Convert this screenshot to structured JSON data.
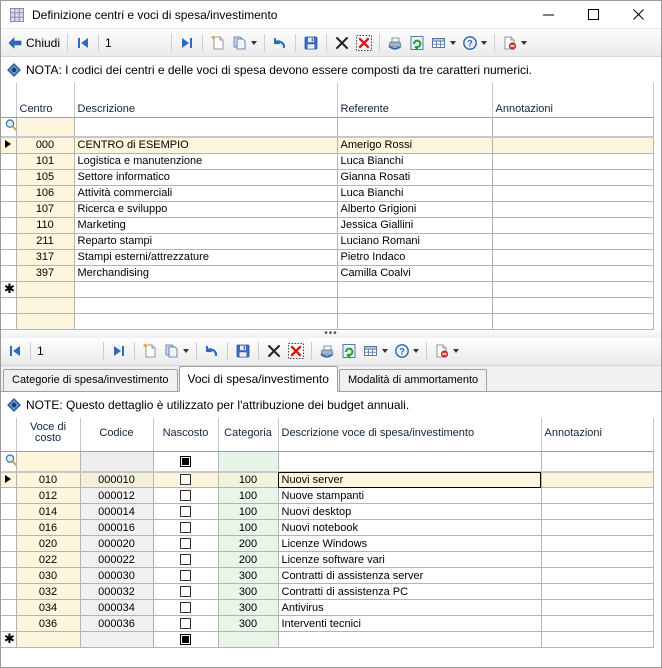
{
  "window": {
    "title": "Definizione centri e voci di spesa/investimento",
    "app_icon": "grid-icon",
    "minimize": "─",
    "maximize": "□",
    "close": "✕"
  },
  "toolbar_top": {
    "close_label": "Chiudi",
    "record_number": "1",
    "items": [
      {
        "name": "close-button",
        "icon": "back-arrow-icon",
        "label": "Chiudi"
      },
      {
        "name": "first-record-button",
        "icon": "first-record-icon"
      },
      {
        "name": "record-number-input",
        "icon": "",
        "value": "1"
      },
      {
        "name": "last-record-button",
        "icon": "last-record-icon"
      },
      {
        "name": "new-record-button",
        "icon": "new-document-icon"
      },
      {
        "name": "duplicate-record-button",
        "icon": "copy-document-icon",
        "dropdown": true
      },
      {
        "name": "undo-button",
        "icon": "undo-icon"
      },
      {
        "name": "save-button",
        "icon": "save-disk-icon"
      },
      {
        "name": "delete-button",
        "icon": "delete-x-icon"
      },
      {
        "name": "delete-all-button",
        "icon": "delete-red-x-icon"
      },
      {
        "name": "print-button",
        "icon": "printer-icon"
      },
      {
        "name": "refresh-button",
        "icon": "refresh-icon"
      },
      {
        "name": "grid-options-button",
        "icon": "table-icon",
        "dropdown": true
      },
      {
        "name": "help-button",
        "icon": "help-icon",
        "dropdown": true
      },
      {
        "name": "export-button",
        "icon": "export-icon",
        "dropdown": true
      }
    ]
  },
  "toolbar_bottom": {
    "record_number": "1",
    "items": [
      {
        "name": "first-record-button",
        "icon": "first-record-icon"
      },
      {
        "name": "record-number-input",
        "value": "1"
      },
      {
        "name": "last-record-button",
        "icon": "last-record-icon"
      },
      {
        "name": "new-record-button",
        "icon": "new-document-icon"
      },
      {
        "name": "duplicate-record-button",
        "icon": "copy-document-icon",
        "dropdown": true
      },
      {
        "name": "undo-button",
        "icon": "undo-icon"
      },
      {
        "name": "save-button",
        "icon": "save-disk-icon"
      },
      {
        "name": "delete-button",
        "icon": "delete-x-icon"
      },
      {
        "name": "delete-all-button",
        "icon": "delete-red-x-icon"
      },
      {
        "name": "print-button",
        "icon": "printer-icon"
      },
      {
        "name": "refresh-button",
        "icon": "refresh-icon"
      },
      {
        "name": "grid-options-button",
        "icon": "table-icon",
        "dropdown": true
      },
      {
        "name": "help-button",
        "icon": "help-icon",
        "dropdown": true
      },
      {
        "name": "export-button",
        "icon": "export-icon",
        "dropdown": true
      }
    ]
  },
  "note_top": {
    "icon": "info-diamond-icon",
    "text": "NOTA: I codici dei centri e delle voci di spesa devono essere composti da tre caratteri numerici."
  },
  "note_bottom": {
    "icon": "info-diamond-icon",
    "text": "NOTE: Questo dettaglio è utilizzato per l'attribuzione dei budget annuali."
  },
  "grid_centri": {
    "columns": [
      "Centro",
      "Descrizione",
      "Referente",
      "Annotazioni"
    ],
    "rows": [
      {
        "centro": "000",
        "descrizione": "CENTRO di ESEMPIO",
        "referente": "Amerigo Rossi",
        "annotazioni": "",
        "current": true
      },
      {
        "centro": "101",
        "descrizione": "Logistica e manutenzione",
        "referente": "Luca Bianchi",
        "annotazioni": ""
      },
      {
        "centro": "105",
        "descrizione": "Settore informatico",
        "referente": "Gianna Rosati",
        "annotazioni": ""
      },
      {
        "centro": "106",
        "descrizione": "Attività commerciali",
        "referente": "Luca Bianchi",
        "annotazioni": ""
      },
      {
        "centro": "107",
        "descrizione": "Ricerca e sviluppo",
        "referente": "Alberto Grigioni",
        "annotazioni": ""
      },
      {
        "centro": "110",
        "descrizione": "Marketing",
        "referente": "Jessica Giallini",
        "annotazioni": ""
      },
      {
        "centro": "211",
        "descrizione": "Reparto stampi",
        "referente": "Luciano Romani",
        "annotazioni": ""
      },
      {
        "centro": "317",
        "descrizione": "Stampi esterni/attrezzature",
        "referente": "Pietro Indaco",
        "annotazioni": ""
      },
      {
        "centro": "397",
        "descrizione": "Merchandising",
        "referente": "Camilla Coalvi",
        "annotazioni": ""
      }
    ],
    "new_row_marker": "✱"
  },
  "tabs": [
    {
      "label": "Categorie di spesa/investimento",
      "active": false
    },
    {
      "label": "Voci di spesa/investimento",
      "active": true
    },
    {
      "label": "Modalità di ammortamento",
      "active": false
    }
  ],
  "grid_voci": {
    "columns": [
      "Voce di costo",
      "Codice",
      "Nascosto",
      "Categoria",
      "Descrizione voce di spesa/investimento",
      "Annotazioni"
    ],
    "rows": [
      {
        "voce": "010",
        "codice": "000010",
        "nascosto": false,
        "categoria": "100",
        "descrizione": "Nuovi server",
        "annotazioni": "",
        "current": true
      },
      {
        "voce": "012",
        "codice": "000012",
        "nascosto": false,
        "categoria": "100",
        "descrizione": "Nuove stampanti",
        "annotazioni": ""
      },
      {
        "voce": "014",
        "codice": "000014",
        "nascosto": false,
        "categoria": "100",
        "descrizione": "Nuovi desktop",
        "annotazioni": ""
      },
      {
        "voce": "016",
        "codice": "000016",
        "nascosto": false,
        "categoria": "100",
        "descrizione": "Nuovi notebook",
        "annotazioni": ""
      },
      {
        "voce": "020",
        "codice": "000020",
        "nascosto": false,
        "categoria": "200",
        "descrizione": "Licenze Windows",
        "annotazioni": ""
      },
      {
        "voce": "022",
        "codice": "000022",
        "nascosto": false,
        "categoria": "200",
        "descrizione": "Licenze software vari",
        "annotazioni": ""
      },
      {
        "voce": "030",
        "codice": "000030",
        "nascosto": false,
        "categoria": "300",
        "descrizione": "Contratti di assistenza server",
        "annotazioni": ""
      },
      {
        "voce": "032",
        "codice": "000032",
        "nascosto": false,
        "categoria": "300",
        "descrizione": "Contratti di assistenza PC",
        "annotazioni": ""
      },
      {
        "voce": "034",
        "codice": "000034",
        "nascosto": false,
        "categoria": "300",
        "descrizione": "Antivirus",
        "annotazioni": ""
      },
      {
        "voce": "036",
        "codice": "000036",
        "nascosto": false,
        "categoria": "300",
        "descrizione": "Interventi tecnici",
        "annotazioni": ""
      }
    ],
    "new_row_marker": "✱"
  },
  "colors": {
    "row_cream": "#fdf6dd",
    "row_grey": "#f1f1f1",
    "row_green": "#eaf5ea",
    "grid_line": "#b4b4b4",
    "header_text": "#10243f"
  },
  "splitter": {
    "handle": "•••"
  }
}
